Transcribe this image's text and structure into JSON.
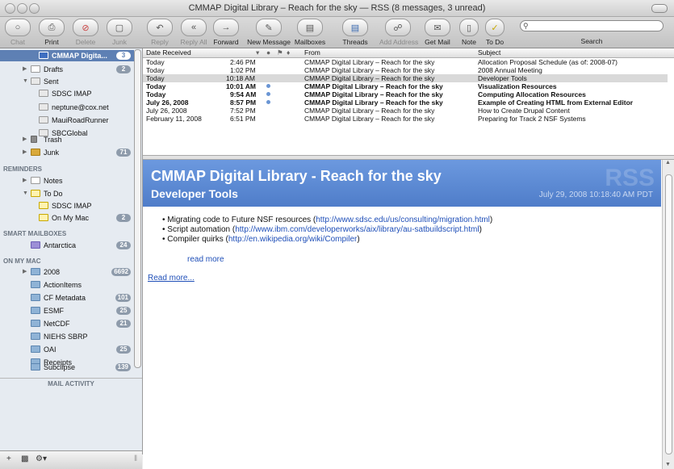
{
  "window": {
    "title": "CMMAP Digital Library – Reach for the sky — RSS (8 messages, 3 unread)"
  },
  "toolbar": {
    "chat": "Chat",
    "print": "Print",
    "delete": "Delete",
    "junk": "Junk",
    "reply": "Reply",
    "reply_all": "Reply All",
    "forward": "Forward",
    "new_message": "New Message",
    "mailboxes": "Mailboxes",
    "threads": "Threads",
    "add_address": "Add Address",
    "get_mail": "Get Mail",
    "note": "Note",
    "to_do": "To Do",
    "search_label": "Search",
    "search_value": ""
  },
  "sidebar": {
    "rss_feed": {
      "label": "CMMAP Digita...",
      "badge": "3"
    },
    "drafts": {
      "label": "Drafts",
      "badge": "2"
    },
    "sent": {
      "label": "Sent"
    },
    "sent_children": [
      "SDSC IMAP",
      "neptune@cox.net",
      "MauiRoadRunner",
      "SBCGlobal"
    ],
    "trash": {
      "label": "Trash"
    },
    "junk": {
      "label": "Junk",
      "badge": "71"
    },
    "reminders_header": "REMINDERS",
    "notes": {
      "label": "Notes"
    },
    "to_do": {
      "label": "To Do"
    },
    "to_do_children": [
      {
        "label": "SDSC IMAP",
        "badge": ""
      },
      {
        "label": "On My Mac",
        "badge": "2"
      }
    ],
    "smart_header": "SMART MAILBOXES",
    "antarctica": {
      "label": "Antarctica",
      "badge": "24"
    },
    "onmymac_header": "ON MY MAC",
    "folders": [
      {
        "label": "2008",
        "badge": "6692"
      },
      {
        "label": "ActionItems",
        "badge": ""
      },
      {
        "label": "CF Metadata",
        "badge": "101"
      },
      {
        "label": "ESMF",
        "badge": "25"
      },
      {
        "label": "NetCDF",
        "badge": "21"
      },
      {
        "label": "NIEHS SBRP",
        "badge": ""
      },
      {
        "label": "OAI",
        "badge": "25"
      },
      {
        "label": "Receipts",
        "badge": ""
      },
      {
        "label": "Subclipse",
        "badge": "139"
      }
    ],
    "activity": "MAIL ACTIVITY"
  },
  "list": {
    "columns": {
      "date": "Date Received",
      "from": "From",
      "subject": "Subject"
    },
    "rows": [
      {
        "date": "Today",
        "time": "2:46 PM",
        "from": "CMMAP Digital Library – Reach for the sky",
        "subject": "Allocation Proposal Schedule (as of: 2008-07)"
      },
      {
        "date": "Today",
        "time": "1:02 PM",
        "from": "CMMAP Digital Library – Reach for the sky",
        "subject": "2008 Annual Meeting"
      },
      {
        "date": "Today",
        "time": "10:18 AM",
        "from": "CMMAP Digital Library – Reach for the sky",
        "subject": "Developer Tools"
      },
      {
        "date": "Today",
        "time": "10:01 AM",
        "from": "CMMAP Digital Library – Reach for the sky",
        "subject": "Visualization Resources"
      },
      {
        "date": "Today",
        "time": "9:54 AM",
        "from": "CMMAP Digital Library – Reach for the sky",
        "subject": "Computing Allocation Resources"
      },
      {
        "date": "July 26, 2008",
        "time": "8:57 PM",
        "from": "CMMAP Digital Library – Reach for the sky",
        "subject": "Example of Creating HTML from External Editor"
      },
      {
        "date": "July 26, 2008",
        "time": "7:52 PM",
        "from": "CMMAP Digital Library – Reach for the sky",
        "subject": "How to Create Drupal Content"
      },
      {
        "date": "February 11, 2008",
        "time": "6:51 PM",
        "from": "CMMAP Digital Library – Reach for the sky",
        "subject": "Preparing for Track 2 NSF Systems"
      }
    ]
  },
  "preview": {
    "watermark": "RSS",
    "feed_title": "CMMAP Digital Library - Reach for the sky",
    "subject": "Developer Tools",
    "date": "July 29, 2008 10:18:40 AM PDT",
    "bullets": [
      {
        "text": "Migrating code to Future NSF resources (",
        "link": "http://www.sdsc.edu/us/consulting/migration.html",
        "end": ")"
      },
      {
        "text": "Script automation (",
        "link": "http://www.ibm.com/developerworks/aix/library/au-satbuildscript.html",
        "end": ")"
      },
      {
        "text": "Compiler quirks (",
        "link": "http://en.wikipedia.org/wiki/Compiler",
        "end": ")"
      }
    ],
    "read_more_inner": "read more",
    "read_more": "Read more..."
  },
  "colors": {
    "selection": "#5e80b4",
    "rss_banner": "#5b88d3",
    "link": "#1f4fb8"
  }
}
